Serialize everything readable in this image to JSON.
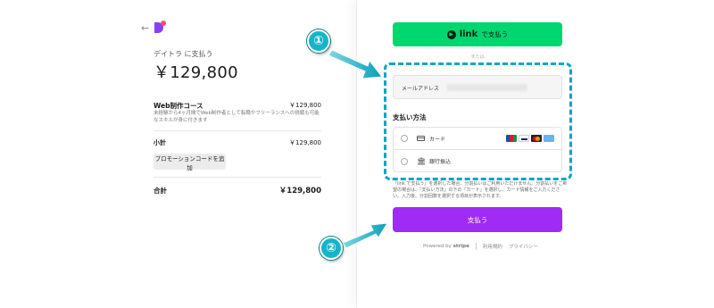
{
  "left": {
    "back_icon": "←",
    "merchant_label": "デイトラ に支払う",
    "amount": "￥129,800",
    "item": {
      "name": "Web制作コース",
      "price": "￥129,800",
      "description": "未経験から4ヶ月間でWeb制作者として転職やフリーランスへの挑戦も可能なスキルが身に付きます"
    },
    "subtotal_label": "小計",
    "subtotal_value": "￥129,800",
    "promo_button": "プロモーションコードを追加",
    "total_label": "合計",
    "total_value": "￥129,800"
  },
  "right": {
    "link_button": {
      "icon": "▶",
      "brand": "link",
      "label": "で支払う"
    },
    "or_text": "または",
    "email_label": "メールアドレス",
    "payment_title": "支払い方法",
    "payment_options": [
      {
        "label": "カード",
        "icon": "card-icon"
      },
      {
        "label": "銀行振込",
        "icon": "bank-icon"
      }
    ],
    "note": "「link で支払う」を選択した場合、分割払いはご利用いただけません。分割払いをご希望の場合は、「支払い方法」の下の「カード」を選択し、カード情報をご入力ください。入力後、分割回数を選択する項目が表示されます。",
    "pay_button": "支払う",
    "footer": {
      "powered": "Powered by",
      "stripe": "stripe",
      "terms": "利用規約",
      "privacy": "プライバシー"
    }
  },
  "annotations": {
    "callout_1": "①",
    "callout_2": "②",
    "accent_color": "#14b5c9"
  }
}
